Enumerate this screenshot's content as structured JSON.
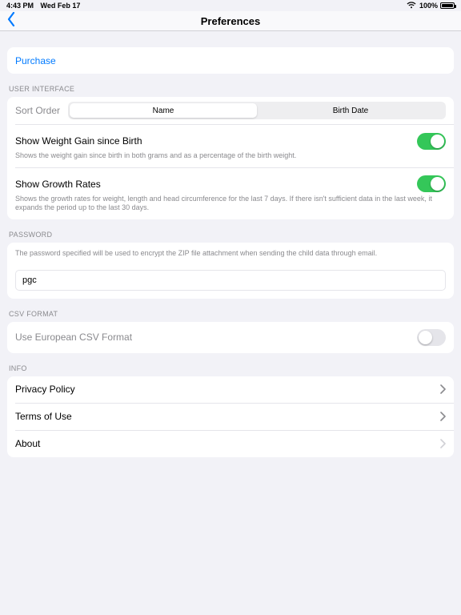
{
  "status": {
    "time": "4:43 PM",
    "date": "Wed Feb 17",
    "battery_pct": "100%"
  },
  "nav": {
    "title": "Preferences"
  },
  "purchase": {
    "label": "Purchase"
  },
  "user_interface": {
    "header": "USER INTERFACE",
    "sort_order_label": "Sort Order",
    "sort_option_name": "Name",
    "sort_option_birth": "Birth Date",
    "weight_gain_label": "Show Weight Gain since Birth",
    "weight_gain_desc": "Shows the weight gain since birth in both grams and as a percentage of the birth weight.",
    "growth_rates_label": "Show Growth Rates",
    "growth_rates_desc": "Shows the growth rates for weight, length and head circumference for the last 7 days. If there isn't sufficient data in the last week, it expands the period up to the last 30 days."
  },
  "password": {
    "header": "PASSWORD",
    "desc": "The password specified will be used to encrypt the ZIP file attachment when sending the child data through email.",
    "value": "pgc"
  },
  "csv": {
    "header": "CSV FORMAT",
    "label": "Use European CSV Format"
  },
  "info": {
    "header": "INFO",
    "privacy": "Privacy Policy",
    "terms": "Terms of Use",
    "about": "About"
  }
}
